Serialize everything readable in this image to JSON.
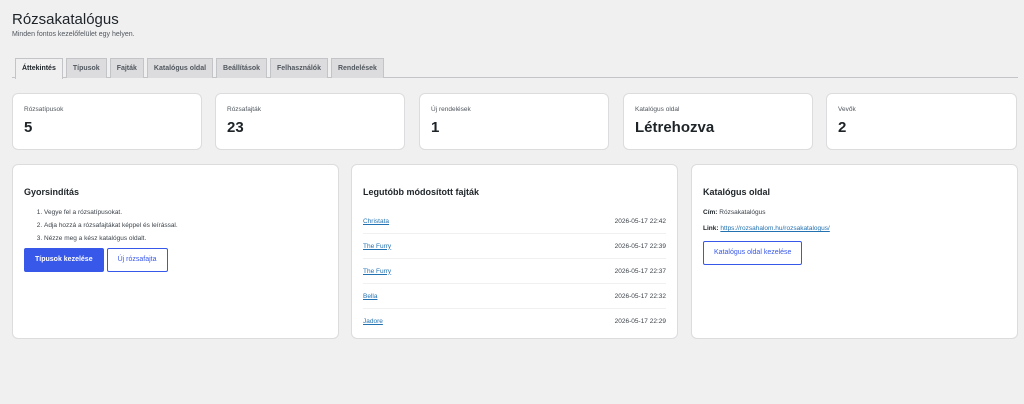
{
  "header": {
    "title": "Rózsakatalógus",
    "subtitle": "Minden fontos kezelőfelület egy helyen."
  },
  "tabs": [
    {
      "label": "Áttekintés",
      "active": true
    },
    {
      "label": "Típusok"
    },
    {
      "label": "Fajták"
    },
    {
      "label": "Katalógus oldal"
    },
    {
      "label": "Beállítások"
    },
    {
      "label": "Felhasználók"
    },
    {
      "label": "Rendelések"
    }
  ],
  "stats": [
    {
      "label": "Rózsatípusok",
      "value": "5"
    },
    {
      "label": "Rózsafajták",
      "value": "23"
    },
    {
      "label": "Új rendelések",
      "value": "1"
    },
    {
      "label": "Katalógus oldal",
      "value": "Létrehozva"
    },
    {
      "label": "Vevők",
      "value": "2"
    }
  ],
  "quickstart": {
    "title": "Gyorsindítás",
    "steps": [
      "Vegye fel a rózsatípusokat.",
      "Adja hozzá a rózsafajtákat képpel és leírással.",
      "Nézze meg a kész katalógus oldalt."
    ],
    "primary_button": "Típusok kezelése",
    "secondary_button": "Új rózsafajta"
  },
  "recent": {
    "title": "Legutóbb módosított fajták",
    "items": [
      {
        "name": "Christata",
        "date": "2026-05-17 22:42"
      },
      {
        "name": "The Furry",
        "date": "2026-05-17 22:39"
      },
      {
        "name": "The Furry",
        "date": "2026-05-17 22:37"
      },
      {
        "name": "Bella",
        "date": "2026-05-17 22:32"
      },
      {
        "name": "Jadore",
        "date": "2026-05-17 22:29"
      }
    ]
  },
  "catalog": {
    "title": "Katalógus oldal",
    "cim_label": "Cím:",
    "cim_value": "Rózsakatalógus",
    "link_label": "Link:",
    "link_value": "https://rozsahalom.hu/rozsakatalogus/",
    "button": "Katalógus oldal kezelése"
  }
}
